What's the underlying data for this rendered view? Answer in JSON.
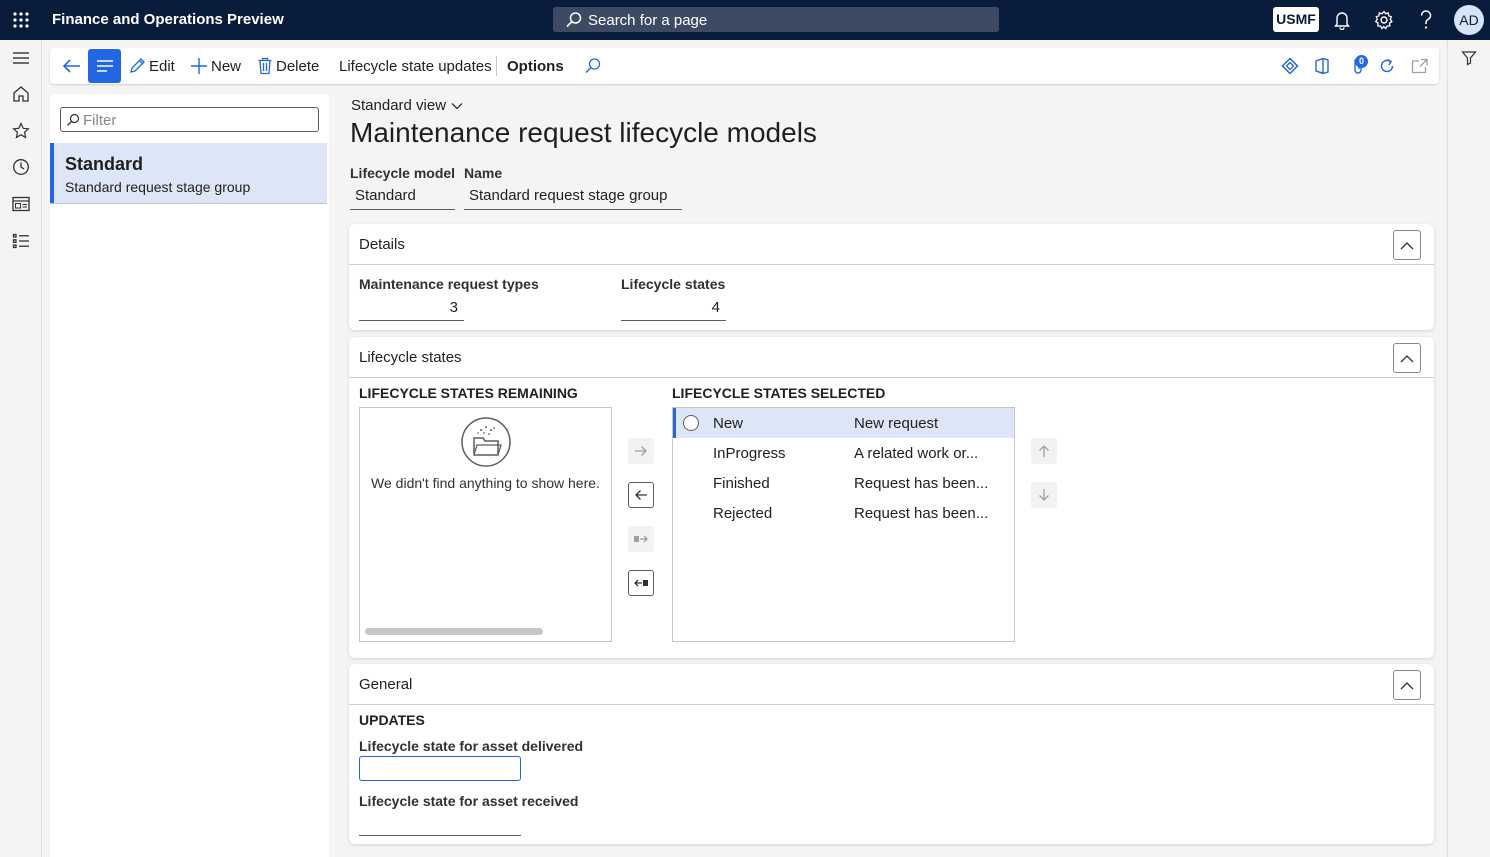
{
  "app": {
    "title": "Finance and Operations Preview",
    "search_placeholder": "Search for a page",
    "company": "USMF",
    "user_initials": "AD"
  },
  "actions": {
    "edit": "Edit",
    "new": "New",
    "delete": "Delete",
    "lifecycle_updates": "Lifecycle state updates",
    "options": "Options",
    "notification_count": "0"
  },
  "list": {
    "filter_placeholder": "Filter",
    "items": [
      {
        "title": "Standard",
        "subtitle": "Standard request stage group"
      }
    ]
  },
  "header": {
    "view_name": "Standard view",
    "page_title": "Maintenance request lifecycle models",
    "model_label": "Lifecycle model",
    "model_value": "Standard",
    "name_label": "Name",
    "name_value": "Standard request stage group"
  },
  "details": {
    "title": "Details",
    "types_label": "Maintenance request types",
    "types_value": "3",
    "states_label": "Lifecycle states",
    "states_value": "4"
  },
  "lifecycle": {
    "title": "Lifecycle states",
    "remaining_title": "LIFECYCLE STATES REMAINING",
    "selected_title": "LIFECYCLE STATES SELECTED",
    "empty_text": "We didn't find anything to show here.",
    "rows": [
      {
        "state": "New",
        "description": "New request"
      },
      {
        "state": "InProgress",
        "description": "A related work or..."
      },
      {
        "state": "Finished",
        "description": "Request has been..."
      },
      {
        "state": "Rejected",
        "description": "Request has been..."
      }
    ]
  },
  "general": {
    "title": "General",
    "updates_title": "UPDATES",
    "delivered_label": "Lifecycle state for asset delivered",
    "delivered_value": "",
    "received_label": "Lifecycle state for asset received",
    "received_value": ""
  },
  "colors": {
    "topbar": "#0a1c3c",
    "accent": "#2266e3",
    "selected_row": "#dce6f7"
  }
}
